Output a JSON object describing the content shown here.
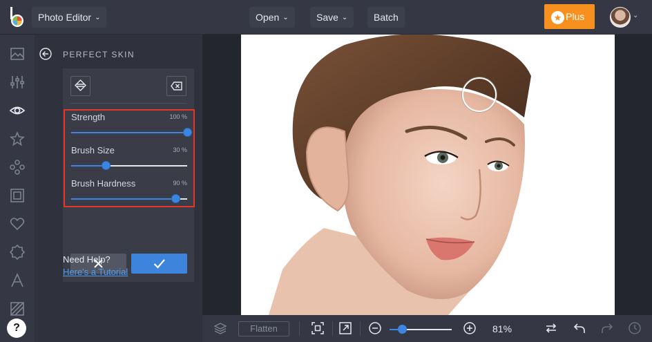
{
  "app": {
    "menu_photo_editor": "Photo Editor",
    "menu_open": "Open",
    "menu_save": "Save",
    "menu_batch": "Batch",
    "plus_label": "Plus",
    "accent_color": "#f7901e"
  },
  "panel": {
    "title": "PERFECT SKIN",
    "sliders": [
      {
        "label": "Strength",
        "value_text": "100 %",
        "value": 1.0
      },
      {
        "label": "Brush Size",
        "value_text": "30 %",
        "value": 0.3
      },
      {
        "label": "Brush Hardness",
        "value_text": "90 %",
        "value": 0.9
      }
    ],
    "need_help": "Need Help?",
    "tutorial_link": "Here's a Tutorial",
    "highlight_color": "#e8352a"
  },
  "rail_icons": [
    "image-icon",
    "adjust-sliders-icon",
    "eye-icon",
    "star-icon",
    "effects-icon",
    "frame-icon",
    "heart-icon",
    "badge-icon",
    "text-icon",
    "texture-icon"
  ],
  "bottom": {
    "flatten_label": "Flatten",
    "zoom_text": "81%",
    "zoom_value": 0.2
  },
  "help_glyph": "?"
}
